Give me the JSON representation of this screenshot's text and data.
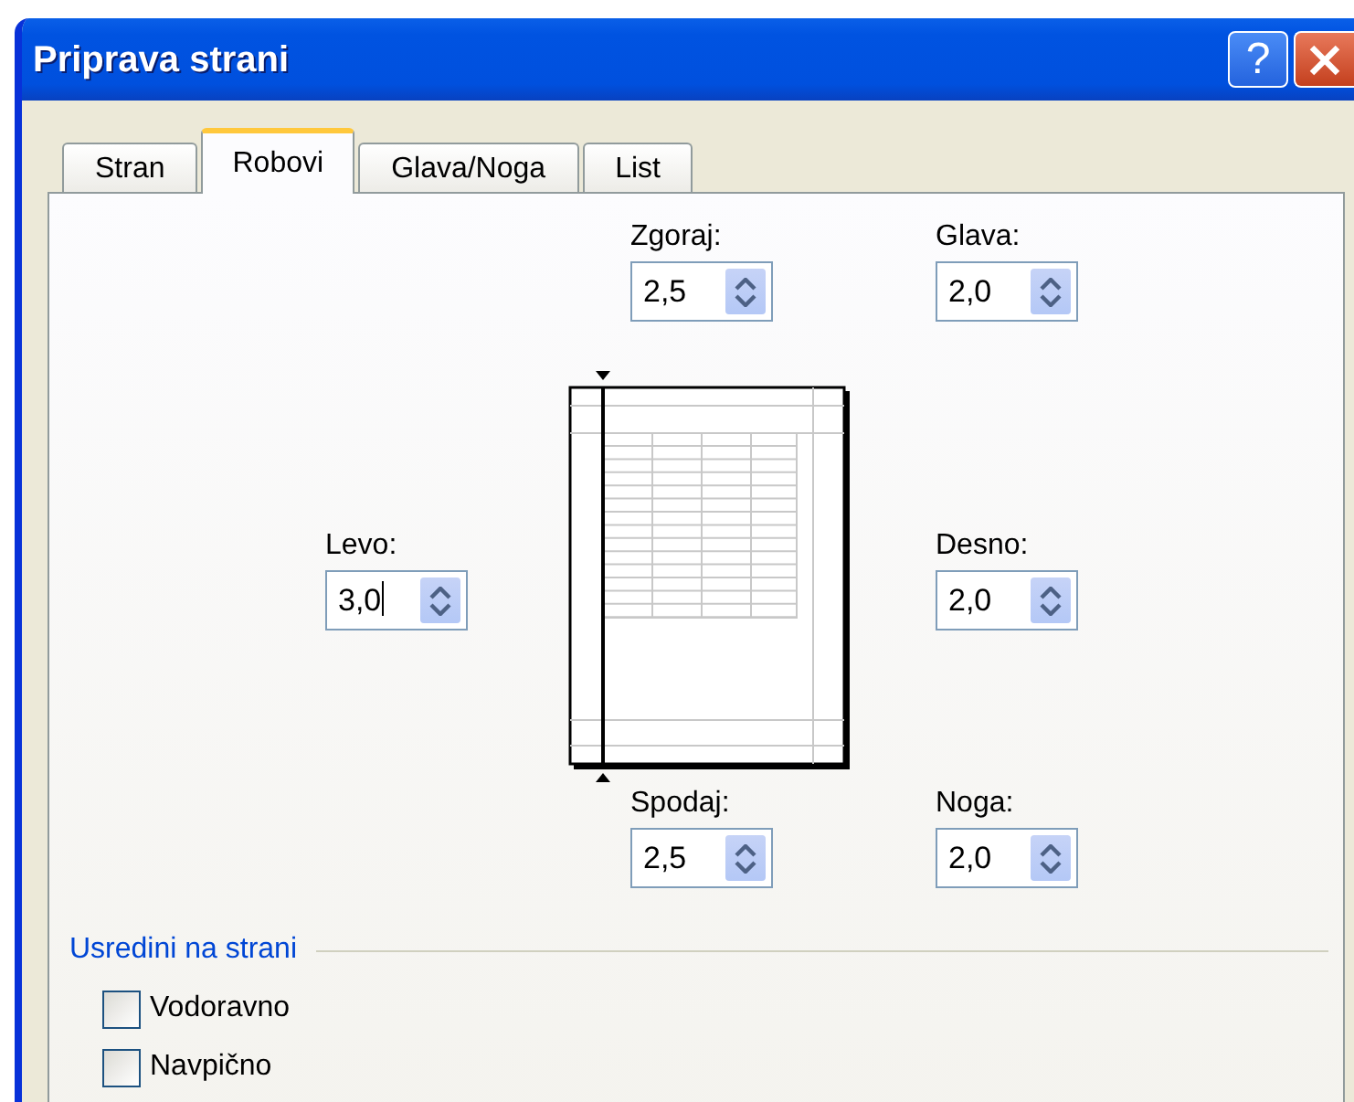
{
  "window": {
    "title": "Priprava strani",
    "help_label": "?"
  },
  "tabs": [
    {
      "label": "Stran",
      "selected": false
    },
    {
      "label": "Robovi",
      "selected": true
    },
    {
      "label": "Glava/Noga",
      "selected": false
    },
    {
      "label": "List",
      "selected": false
    }
  ],
  "margins": [
    {
      "kind": "top",
      "label": "Zgoraj:",
      "value": "2,5",
      "focused": false
    },
    {
      "kind": "header",
      "label": "Glava:",
      "value": "2,0",
      "focused": false
    },
    {
      "kind": "left",
      "label": "Levo:",
      "value": "3,0",
      "focused": true
    },
    {
      "kind": "right",
      "label": "Desno:",
      "value": "2,0",
      "focused": false
    },
    {
      "kind": "bottom",
      "label": "Spodaj:",
      "value": "2,5",
      "focused": false
    },
    {
      "kind": "footer",
      "label": "Noga:",
      "value": "2,0",
      "focused": false
    }
  ],
  "center_on_page": {
    "title": "Usredini na strani",
    "options": [
      {
        "label": "Vodoravno",
        "checked": false
      },
      {
        "label": "Navpično",
        "checked": false
      }
    ]
  }
}
